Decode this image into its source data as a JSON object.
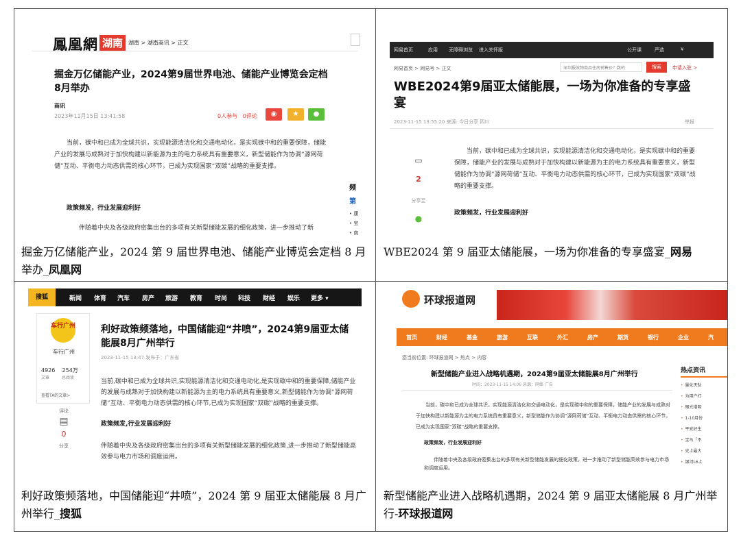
{
  "c1": {
    "logo": "鳳凰網",
    "logo_region": "湖南",
    "breadcrumb": "湖南 > 湖南商讯 > 正文",
    "title": "掘金万亿储能产业，2024第9届世界电池、储能产业博览会定档8月举办",
    "source": "商讯",
    "time": "2023年11月15日 13:41:58",
    "participants": "0人参与",
    "comments": "0评论",
    "body": "当前，碳中和已成为全球共识，实现能源清洁化和交通电动化，是实现碳中和的重要保障，储能产业的发展与成熟对于加快构建以新能源为主的电力系统具有重要意义，新型储能作为协调“源网荷储”互动、平衡电力动态供需的核心环节，已成为实现国家“双碳”战略的重要支撑。",
    "section": "政策频发，行业发展迎利好",
    "body2": "伴随着中央及各级政府密集出台的多项有关新型储能发展的细化政策，进一步推动了新",
    "side_head": "频",
    "side_link": "第",
    "side_items": [
      "• 康",
      "• 宝",
      "• 南"
    ]
  },
  "c2": {
    "topnav": [
      "网易首页",
      "应用",
      "无障碍浏览",
      "进入关怀版"
    ],
    "topnav_right": [
      "公开课",
      "严选",
      "¥"
    ],
    "breadcrumb": "网易首页 > 网易号 > 正文",
    "search_placeholder": "深圳报效物商品住房销售价？数的",
    "search_button": "搜索",
    "enter": "申请入驻 >",
    "title": "WBE2024第9届亚太储能展，一场为你准备的专享盛宴",
    "meta": "2023-11-15 13:55:20  来源: 今日分享  四川",
    "report": "举报",
    "comment_count": "2",
    "share_label": "分享至",
    "body": "当前，碳中和已成为全球共识，实现能源清洁化和交通电动化，是实现碳中和的重要保障，储能产业的发展与成熟对于加快构建以新能源为主的电力系统具有重要意义，新型储能作为协调“源网荷储”互动、平衡电力动态供需的核心环节，已成为实现国家“双碳”战略的重要支撑。",
    "section": "政策频发，行业发展迎利好"
  },
  "c3": {
    "logo": "搜狐",
    "nav": [
      "新闻",
      "体育",
      "汽车",
      "房产",
      "旅游",
      "教育",
      "时尚",
      "科技",
      "财经",
      "娱乐",
      "更多 ▾"
    ],
    "avatar_text": "车行广州",
    "author": "车行广州",
    "articles": "4926",
    "articles_label": "文章",
    "reads": "254万",
    "reads_label": "总阅读",
    "more": "查看TA的文章>",
    "comment_label": "评论",
    "comment_count": "0",
    "share_label": "分享",
    "title": "利好政策频落地，中国储能迎“井喷”，2024第9届亚太储能展8月广州举行",
    "meta": "2023-11-15 13:47    发布于：广东省",
    "body": "当前,碳中和已成为全球共识,实现能源清洁化和交通电动化,是实现碳中和的重要保障,储能产业的发展与成熟对于加快构建以新能源为主的电力系统具有重要意义,新型储能作为协调“源网荷储”互动、平衡电力动态供需的核心环节,已成为实现国家“双碳”战略的重要支撑。",
    "section": "政策频发,行业发展迎利好",
    "body2": "伴随着中央及各级政府密集出台的多项有关新型储能发展的细化政策,进一步推动了新型储能高效参与电力市场和调度运用。"
  },
  "c4": {
    "logo": "环球报道网",
    "nav": [
      "首页",
      "财经",
      "基金",
      "旅游",
      "互联",
      "外汇",
      "房产",
      "期货",
      "银行",
      "企业",
      "汽"
    ],
    "breadcrumb": "您当前位置: 环球报道网 > 热点 > 内容",
    "title": "新型储能产业进入战略机遇期，2024第9届亚太储能展8月广州举行",
    "meta": "时间：2023-11-15 14:06  来源：网络  广告",
    "body": "当前，碳中和已成为全球共识，实现能源清洁化和交通电动化，是实现碳中和的重要保障，储能产业的发展与成熟对于加快构建以新能源为主的电力系统具有重要意义，新型储能作为协调“源网荷储”互动、平衡电力动态供需的核心环节，已成为实现国家“双碳”战略的重要支撑。",
    "section": "政策频发，行业发展迎利好",
    "body2": "伴随着中央及各级政府密集出台的多项有关新型储能发展的细化政策，进一步推动了新型储能高效参与电力市场和调度运用。",
    "hot_title": "热点资讯",
    "hot_items": [
      "量化天轨",
      "为用户打",
      "眼光增明",
      "1-10月份",
      "平安好生",
      "宝马「不",
      "史上最大",
      "银河L6上",
      "无良管理"
    ]
  },
  "captions": {
    "c1_text": "掘金万亿储能产业，2024 第 9 届世界电池、储能产业博览会定档 8 月举办_",
    "c1_src": "凤凰网",
    "c2_text": "WBE2024 第 9 届亚太储能展，一场为你准备的专享盛宴_",
    "c2_src": "网易",
    "c3_text": "利好政策频落地，中国储能迎“井喷”，2024 第 9 届亚太储能展 8 月广州举行_",
    "c3_src": "搜狐",
    "c4_text": "新型储能产业进入战略机遇期，2024 第 9 届亚太储能展 8 月广州举行-",
    "c4_src": "环球报道网"
  },
  "colors": {
    "ifeng_red": "#e43a2e",
    "sohu_yellow": "#f3b620",
    "huanqiu_orange": "#f07b1f"
  }
}
